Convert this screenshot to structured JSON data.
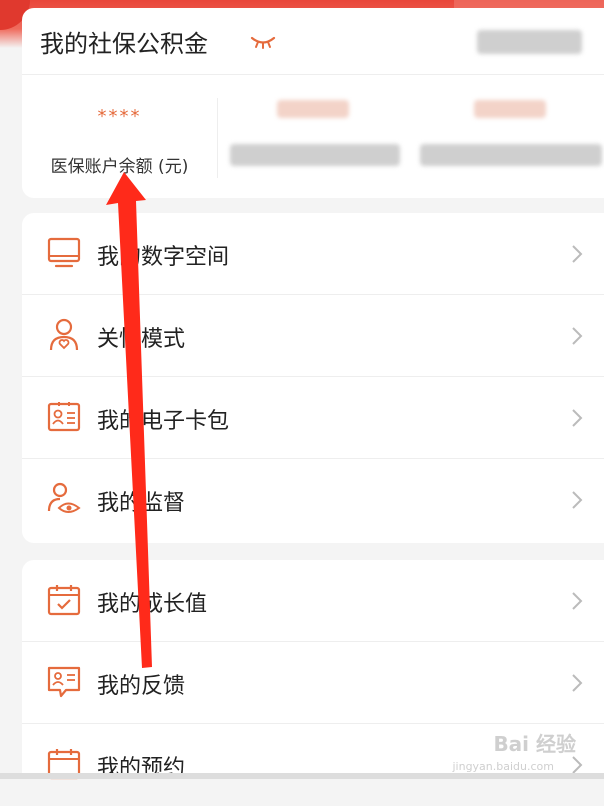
{
  "header": {
    "title": "我的社保公积金"
  },
  "summary": {
    "medical_balance_value": "****",
    "medical_balance_label": "医保账户余额 (元)"
  },
  "menu1": {
    "items": [
      {
        "label": "我的数字空间",
        "icon": "monitor-icon"
      },
      {
        "label": "关怀模式",
        "icon": "care-person-icon"
      },
      {
        "label": "我的电子卡包",
        "icon": "id-card-icon"
      },
      {
        "label": "我的监督",
        "icon": "supervise-eye-icon"
      }
    ]
  },
  "menu2": {
    "items": [
      {
        "label": "我的成长值",
        "icon": "calendar-check-icon"
      },
      {
        "label": "我的反馈",
        "icon": "feedback-icon"
      },
      {
        "label": "我的预约",
        "icon": "calendar-icon"
      }
    ]
  },
  "colors": {
    "accent": "#e56b3d",
    "brand_red": "#e9463a",
    "annotation_arrow": "#ff2a1a"
  },
  "watermark": {
    "text": "Bai 经验",
    "url": "jingyan.baidu.com"
  }
}
